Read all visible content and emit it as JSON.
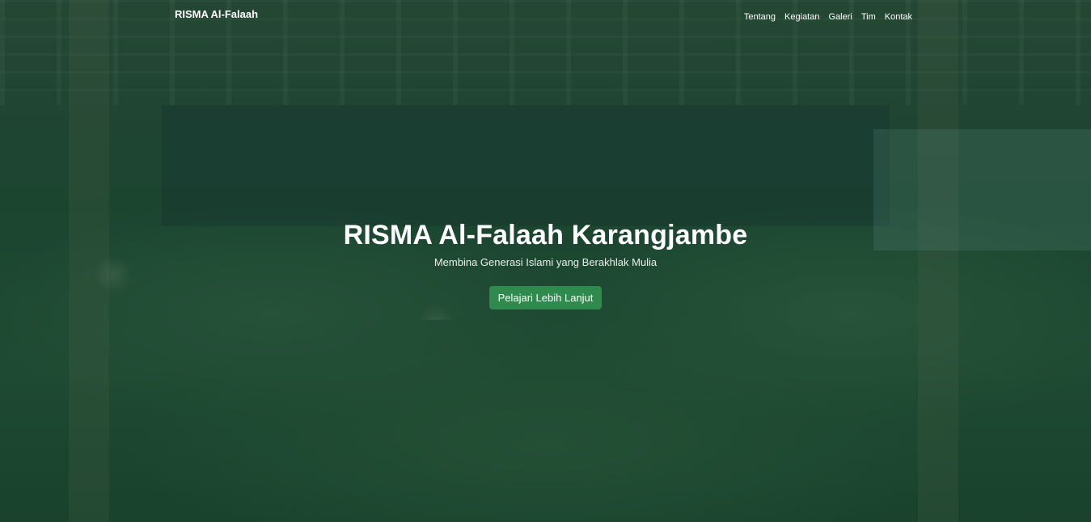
{
  "navbar": {
    "brand": "RISMA Al-Falaah",
    "links": [
      "Tentang",
      "Kegiatan",
      "Galeri",
      "Tim",
      "Kontak"
    ]
  },
  "hero": {
    "title": "RISMA Al-Falaah Karangjambe",
    "subtitle": "Membina Generasi Islami yang Berakhlak Mulia",
    "cta_label": "Pelajari Lebih Lanjut",
    "background_image": "group-photo-background"
  },
  "colors": {
    "overlay": "#185c38",
    "button": "#2f8a4e",
    "text": "#ffffff"
  }
}
